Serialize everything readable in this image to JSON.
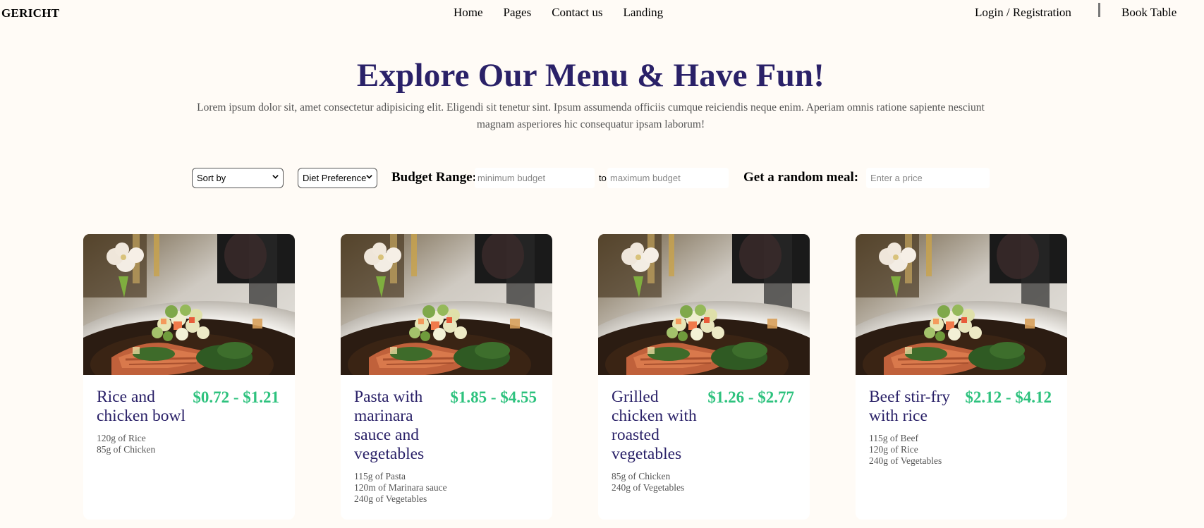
{
  "nav": {
    "brand": "GERICHT",
    "links": [
      "Home",
      "Pages",
      "Contact us",
      "Landing"
    ],
    "login": "Login / Registration",
    "book": "Book Table"
  },
  "hero": {
    "title": "Explore Our Menu & Have Fun!",
    "subtitle": "Lorem ipsum dolor sit, amet consectetur adipisicing elit. Eligendi sit tenetur sint. Ipsum assumenda officiis cumque reiciendis neque enim. Aperiam omnis ratione sapiente nesciunt magnam asperiores hic consequatur ipsam laborum!"
  },
  "filters": {
    "sort": "Sort by",
    "diet": "Diet Preference",
    "budget_label": "Budget Range:",
    "min_placeholder": "minimum budget",
    "to": "to",
    "max_placeholder": "maximum budget",
    "random_label": "Get a random meal:",
    "price_placeholder": "Enter a price"
  },
  "meals": [
    {
      "name": "Rice and chicken bowl",
      "price": "$0.72 - $1.21",
      "ingredients": [
        "120g of Rice",
        "85g of Chicken"
      ]
    },
    {
      "name": "Pasta with marinara sauce and vegetables",
      "price": "$1.85 - $4.55",
      "ingredients": [
        "115g of Pasta",
        "120m of Marinara sauce",
        "240g of Vegetables"
      ]
    },
    {
      "name": "Grilled chicken with roasted vegetables",
      "price": "$1.26 - $2.77",
      "ingredients": [
        "85g of Chicken",
        "240g of Vegetables"
      ]
    },
    {
      "name": "Beef stir-fry with rice",
      "price": "$2.12 - $4.12",
      "ingredients": [
        "115g of Beef",
        "120g of Rice",
        "240g of Vegetables"
      ]
    }
  ],
  "colors": {
    "background": "#fffbf6",
    "title": "#2a2168",
    "price": "#2ec27e"
  },
  "icons": [
    "chevron-down-icon"
  ]
}
